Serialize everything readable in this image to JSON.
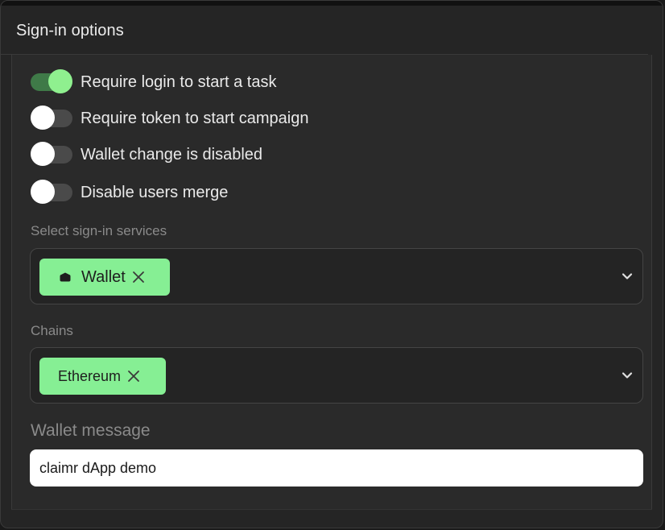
{
  "header": {
    "title": "Sign-in options"
  },
  "toggles": [
    {
      "label": "Require login to start a task",
      "on": true
    },
    {
      "label": "Require token to start campaign",
      "on": false
    },
    {
      "label": "Wallet change is disabled",
      "on": false
    },
    {
      "label": "Disable users merge",
      "on": false
    }
  ],
  "services": {
    "label": "Select sign-in services",
    "selected": [
      {
        "label": "Wallet",
        "icon": "wallet-icon"
      }
    ],
    "dropdown_icon": "chevron-down-icon"
  },
  "chains": {
    "label": "Chains",
    "selected": [
      {
        "label": "Ethereum"
      }
    ],
    "dropdown_icon": "chevron-down-icon"
  },
  "wallet_message": {
    "label": "Wallet message",
    "value": "claimr dApp demo"
  },
  "colors": {
    "accent": "#86ef94",
    "toggle_on_track": "#3f7a48",
    "panel_bg": "#252525"
  }
}
